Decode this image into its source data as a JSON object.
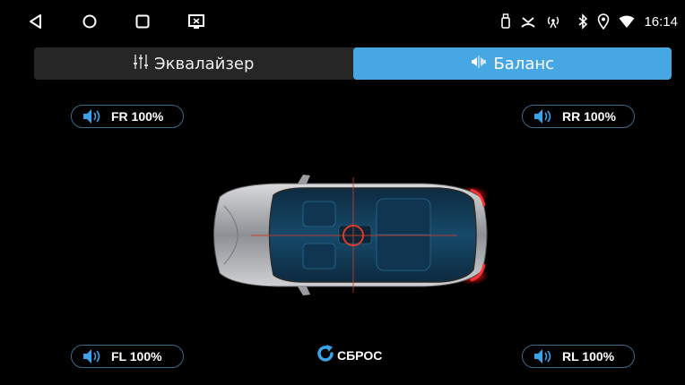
{
  "status": {
    "time": "16:14"
  },
  "tabs": [
    {
      "label": "Эквалайзер",
      "active": false,
      "icon": "equalizer-icon"
    },
    {
      "label": "Баланс",
      "active": true,
      "icon": "balance-icon"
    }
  ],
  "speakers": {
    "fr": "FR 100%",
    "rr": "RR 100%",
    "fl": "FL 100%",
    "rl": "RL 100%"
  },
  "reset_label": "СБРОС",
  "colors": {
    "accent": "#47a7e3",
    "tab_bg": "#262626",
    "pill_border": "#3a6a8a",
    "speaker_icon": "#3aa3ea"
  }
}
